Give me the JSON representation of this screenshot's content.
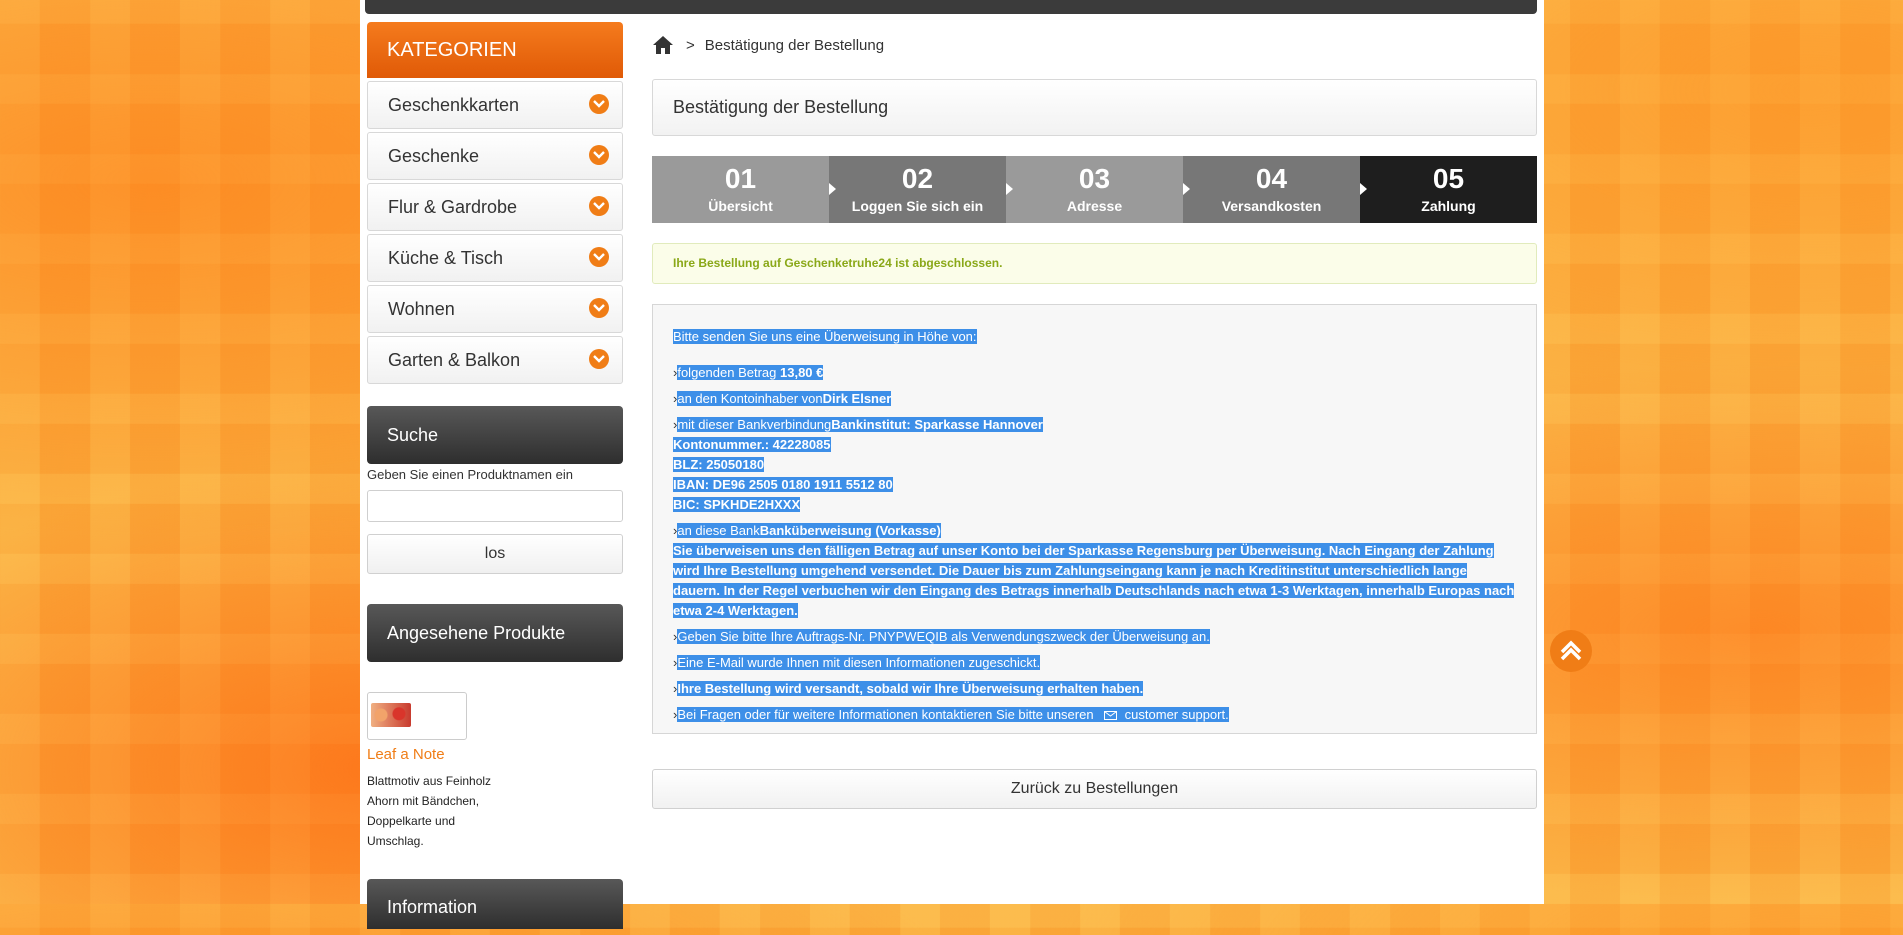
{
  "sidebar": {
    "categories_title": "KATEGORIEN",
    "categories": [
      {
        "label": "Geschenkkarten"
      },
      {
        "label": "Geschenke"
      },
      {
        "label": "Flur & Gardrobe"
      },
      {
        "label": "Küche & Tisch"
      },
      {
        "label": "Wohnen"
      },
      {
        "label": "Garten & Balkon"
      }
    ],
    "search_title": "Suche",
    "search_hint": "Geben Sie einen Produktnamen ein",
    "search_value": "",
    "search_button": "los",
    "viewed_title": "Angesehene Produkte",
    "viewed_product": {
      "name": "Leaf a Note",
      "desc": "Blattmotiv aus Feinholz Ahorn mit Bändchen, Doppelkarte und Umschlag."
    },
    "info_title": "Information"
  },
  "breadcrumb": {
    "separator": ">",
    "current": "Bestätigung der Bestellung"
  },
  "page_title": "Bestätigung der Bestellung",
  "steps": [
    {
      "num": "01",
      "label": "Übersicht",
      "color": "#9a9a9a"
    },
    {
      "num": "02",
      "label": "Loggen Sie sich ein",
      "color": "#777777"
    },
    {
      "num": "03",
      "label": "Adresse",
      "color": "#9a9a9a"
    },
    {
      "num": "04",
      "label": "Versandkosten",
      "color": "#777777"
    },
    {
      "num": "05",
      "label": "Zahlung",
      "color": "#1e1e1e"
    }
  ],
  "notice": "Ihre Bestellung auf Geschenketruhe24 ist abgeschlossen.",
  "payment": {
    "intro": "Bitte senden Sie uns eine Überweisung in Höhe von:",
    "amount_label": "folgenden Betrag",
    "amount_value": "13,80 €",
    "holder_label": "an den Kontoinhaber von",
    "holder_value": "Dirk Elsner",
    "bank_label": "mit dieser Bankverbindung",
    "bank_line1": "Bankinstitut: Sparkasse Hannover",
    "bank_line2": "Kontonummer.: 42228085",
    "bank_line3": "BLZ: 25050180",
    "bank_line4": "IBAN: DE96 2505 0180 1911 5512 80",
    "bank_line5": "BIC: SPKHDE2HXXX",
    "address_label": "an diese Bank",
    "address_value": "Banküberweisung (Vorkasse)",
    "address_desc": "Sie überweisen uns den fälligen Betrag auf unser Konto bei der Sparkasse Regensburg per Überweisung. Nach Eingang der Zahlung wird Ihre Bestellung umgehend versendet. Die Dauer bis zum Zahlungseingang kann je nach Kreditinstitut unterschiedlich lange dauern. In der Regel verbuchen wir den Eingang des Betrags innerhalb Deutschlands nach etwa 1-3 Werktagen, innerhalb Europas nach etwa 2-4 Werktagen.",
    "reference": "Geben Sie bitte Ihre Auftrags-Nr. PNYPWEQIB als Verwendungszweck der Überweisung an.",
    "email_info": "Eine E-Mail wurde Ihnen mit diesen Informationen zugeschickt.",
    "shipping_info": "Ihre Bestellung wird versandt, sobald wir Ihre Überweisung erhalten haben.",
    "support_text": "Bei Fragen oder für weitere Informationen kontaktieren Sie bitte unseren",
    "support_link": "customer support."
  },
  "back_button": "Zurück zu Bestellungen"
}
